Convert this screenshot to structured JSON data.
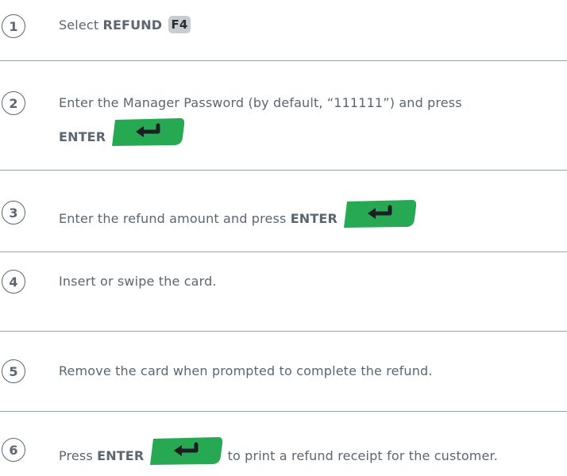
{
  "steps": [
    {
      "number": "1",
      "text_before": "Select ",
      "bold_label": "REFUND",
      "key_label": "F4"
    },
    {
      "number": "2",
      "line1": "Enter the Manager Password (by default, “111111”) and press",
      "bold_label": "ENTER"
    },
    {
      "number": "3",
      "text_before": "Enter the refund amount and press ",
      "bold_label": "ENTER"
    },
    {
      "number": "4",
      "text": "Insert or swipe the card."
    },
    {
      "number": "5",
      "text": "Remove the card when prompted to complete the refund."
    },
    {
      "number": "6",
      "text_before": "Press ",
      "bold_label": "ENTER",
      "text_after": " to print a refund receipt for the customer."
    }
  ],
  "icons": {
    "enter_key": "enter-return-arrow-icon"
  },
  "colors": {
    "text": "#5b6670",
    "enter_key_green": "#27a852",
    "f4_key_gray": "#c9ccd0",
    "divider": "#9aa1a8"
  }
}
